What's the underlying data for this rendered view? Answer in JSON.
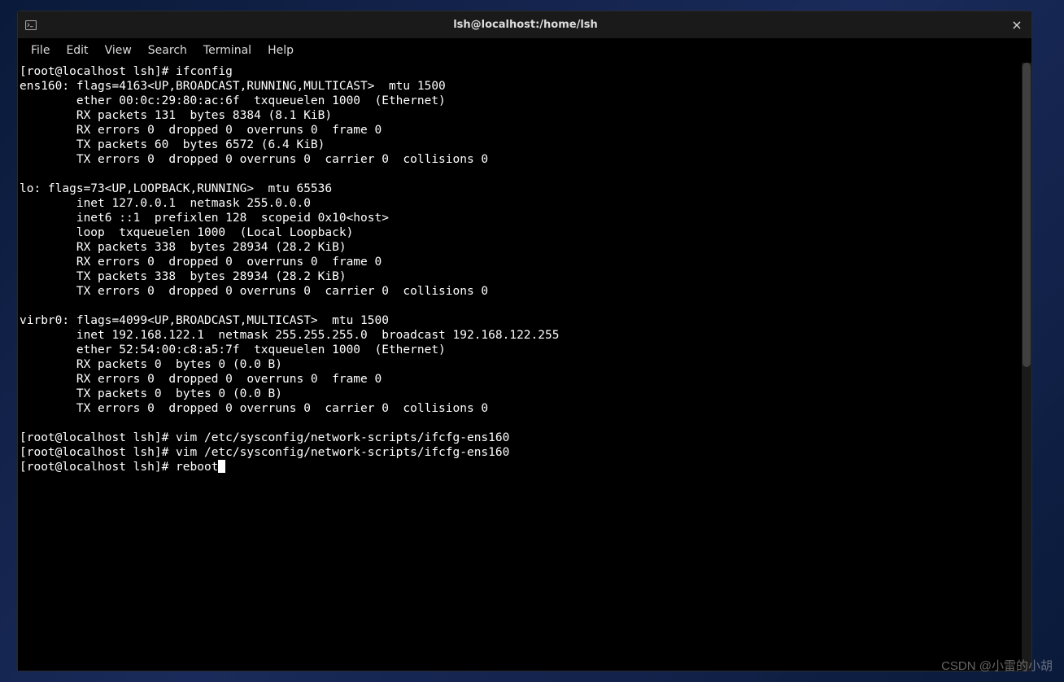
{
  "window": {
    "title": "lsh@localhost:/home/lsh"
  },
  "menubar": {
    "items": [
      {
        "label": "File"
      },
      {
        "label": "Edit"
      },
      {
        "label": "View"
      },
      {
        "label": "Search"
      },
      {
        "label": "Terminal"
      },
      {
        "label": "Help"
      }
    ]
  },
  "terminal": {
    "lines": [
      "[root@localhost lsh]# ifconfig",
      "ens160: flags=4163<UP,BROADCAST,RUNNING,MULTICAST>  mtu 1500",
      "        ether 00:0c:29:80:ac:6f  txqueuelen 1000  (Ethernet)",
      "        RX packets 131  bytes 8384 (8.1 KiB)",
      "        RX errors 0  dropped 0  overruns 0  frame 0",
      "        TX packets 60  bytes 6572 (6.4 KiB)",
      "        TX errors 0  dropped 0 overruns 0  carrier 0  collisions 0",
      "",
      "lo: flags=73<UP,LOOPBACK,RUNNING>  mtu 65536",
      "        inet 127.0.0.1  netmask 255.0.0.0",
      "        inet6 ::1  prefixlen 128  scopeid 0x10<host>",
      "        loop  txqueuelen 1000  (Local Loopback)",
      "        RX packets 338  bytes 28934 (28.2 KiB)",
      "        RX errors 0  dropped 0  overruns 0  frame 0",
      "        TX packets 338  bytes 28934 (28.2 KiB)",
      "        TX errors 0  dropped 0 overruns 0  carrier 0  collisions 0",
      "",
      "virbr0: flags=4099<UP,BROADCAST,MULTICAST>  mtu 1500",
      "        inet 192.168.122.1  netmask 255.255.255.0  broadcast 192.168.122.255",
      "        ether 52:54:00:c8:a5:7f  txqueuelen 1000  (Ethernet)",
      "        RX packets 0  bytes 0 (0.0 B)",
      "        RX errors 0  dropped 0  overruns 0  frame 0",
      "        TX packets 0  bytes 0 (0.0 B)",
      "        TX errors 0  dropped 0 overruns 0  carrier 0  collisions 0",
      "",
      "[root@localhost lsh]# vim /etc/sysconfig/network-scripts/ifcfg-ens160",
      "[root@localhost lsh]# vim /etc/sysconfig/network-scripts/ifcfg-ens160"
    ],
    "current_line_prefix": "[root@localhost lsh]# reboot"
  },
  "watermark": "CSDN @小雷的小胡"
}
